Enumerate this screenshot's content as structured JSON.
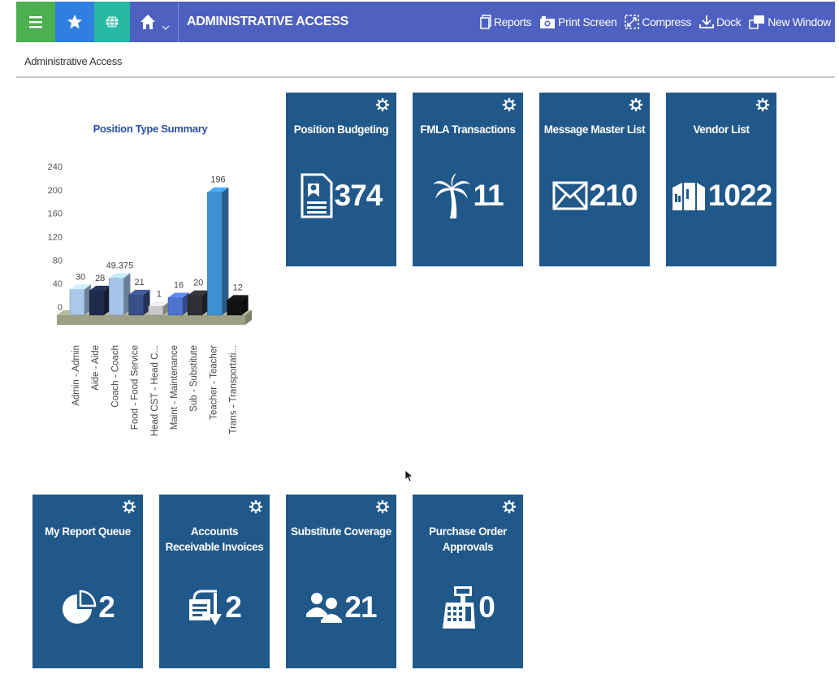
{
  "header": {
    "title": "ADMINISTRATIVE ACCESS",
    "actions": [
      "Reports",
      "Print Screen",
      "Compress",
      "Dock",
      "New Window"
    ]
  },
  "breadcrumb": "Administrative Access",
  "chart_data": {
    "type": "bar",
    "title": "Position Type Summary",
    "categories": [
      "Admin - Admin",
      "Aide - Aide",
      "Coach - Coach",
      "Food - Food Service",
      "Head CST - Head C...",
      "Maint - Maintenance",
      "Sub - Substitute",
      "Teacher - Teacher",
      "Trans - Transportati..."
    ],
    "values": [
      30,
      28,
      49.375,
      21,
      1,
      16,
      20,
      196,
      12
    ],
    "value_labels": [
      "30",
      "28",
      "49.375",
      "21",
      "1",
      "16",
      "20",
      "196",
      "12"
    ],
    "yticks": [
      "240",
      "200",
      "160",
      "120",
      "80",
      "40",
      "0"
    ],
    "ylim": [
      0,
      240
    ],
    "colors": [
      "#a9c8ea",
      "#1f2b4d",
      "#a6c4ea",
      "#3a4f86",
      "#c8c8c8",
      "#4f74cf",
      "#2e2e35",
      "#3f8fd3",
      "#121214"
    ]
  },
  "tiles": [
    {
      "title": "Position Budgeting",
      "count": "374",
      "icon": "contact-card-icon"
    },
    {
      "title": "FMLA Transactions",
      "count": "11",
      "icon": "palm-tree-icon"
    },
    {
      "title": "Message Master List",
      "count": "210",
      "icon": "envelope-icon"
    },
    {
      "title": "Vendor List",
      "count": "1022",
      "icon": "warehouse-icon"
    },
    {
      "title": "My Report Queue",
      "count": "2",
      "icon": "pie-chart-icon"
    },
    {
      "title": "Accounts Receivable Invoices",
      "count": "2",
      "icon": "invoice-arrow-icon"
    },
    {
      "title": "Substitute Coverage",
      "count": "21",
      "icon": "people-icon"
    },
    {
      "title": "Purchase Order Approvals",
      "count": "0",
      "icon": "cash-register-icon"
    }
  ]
}
